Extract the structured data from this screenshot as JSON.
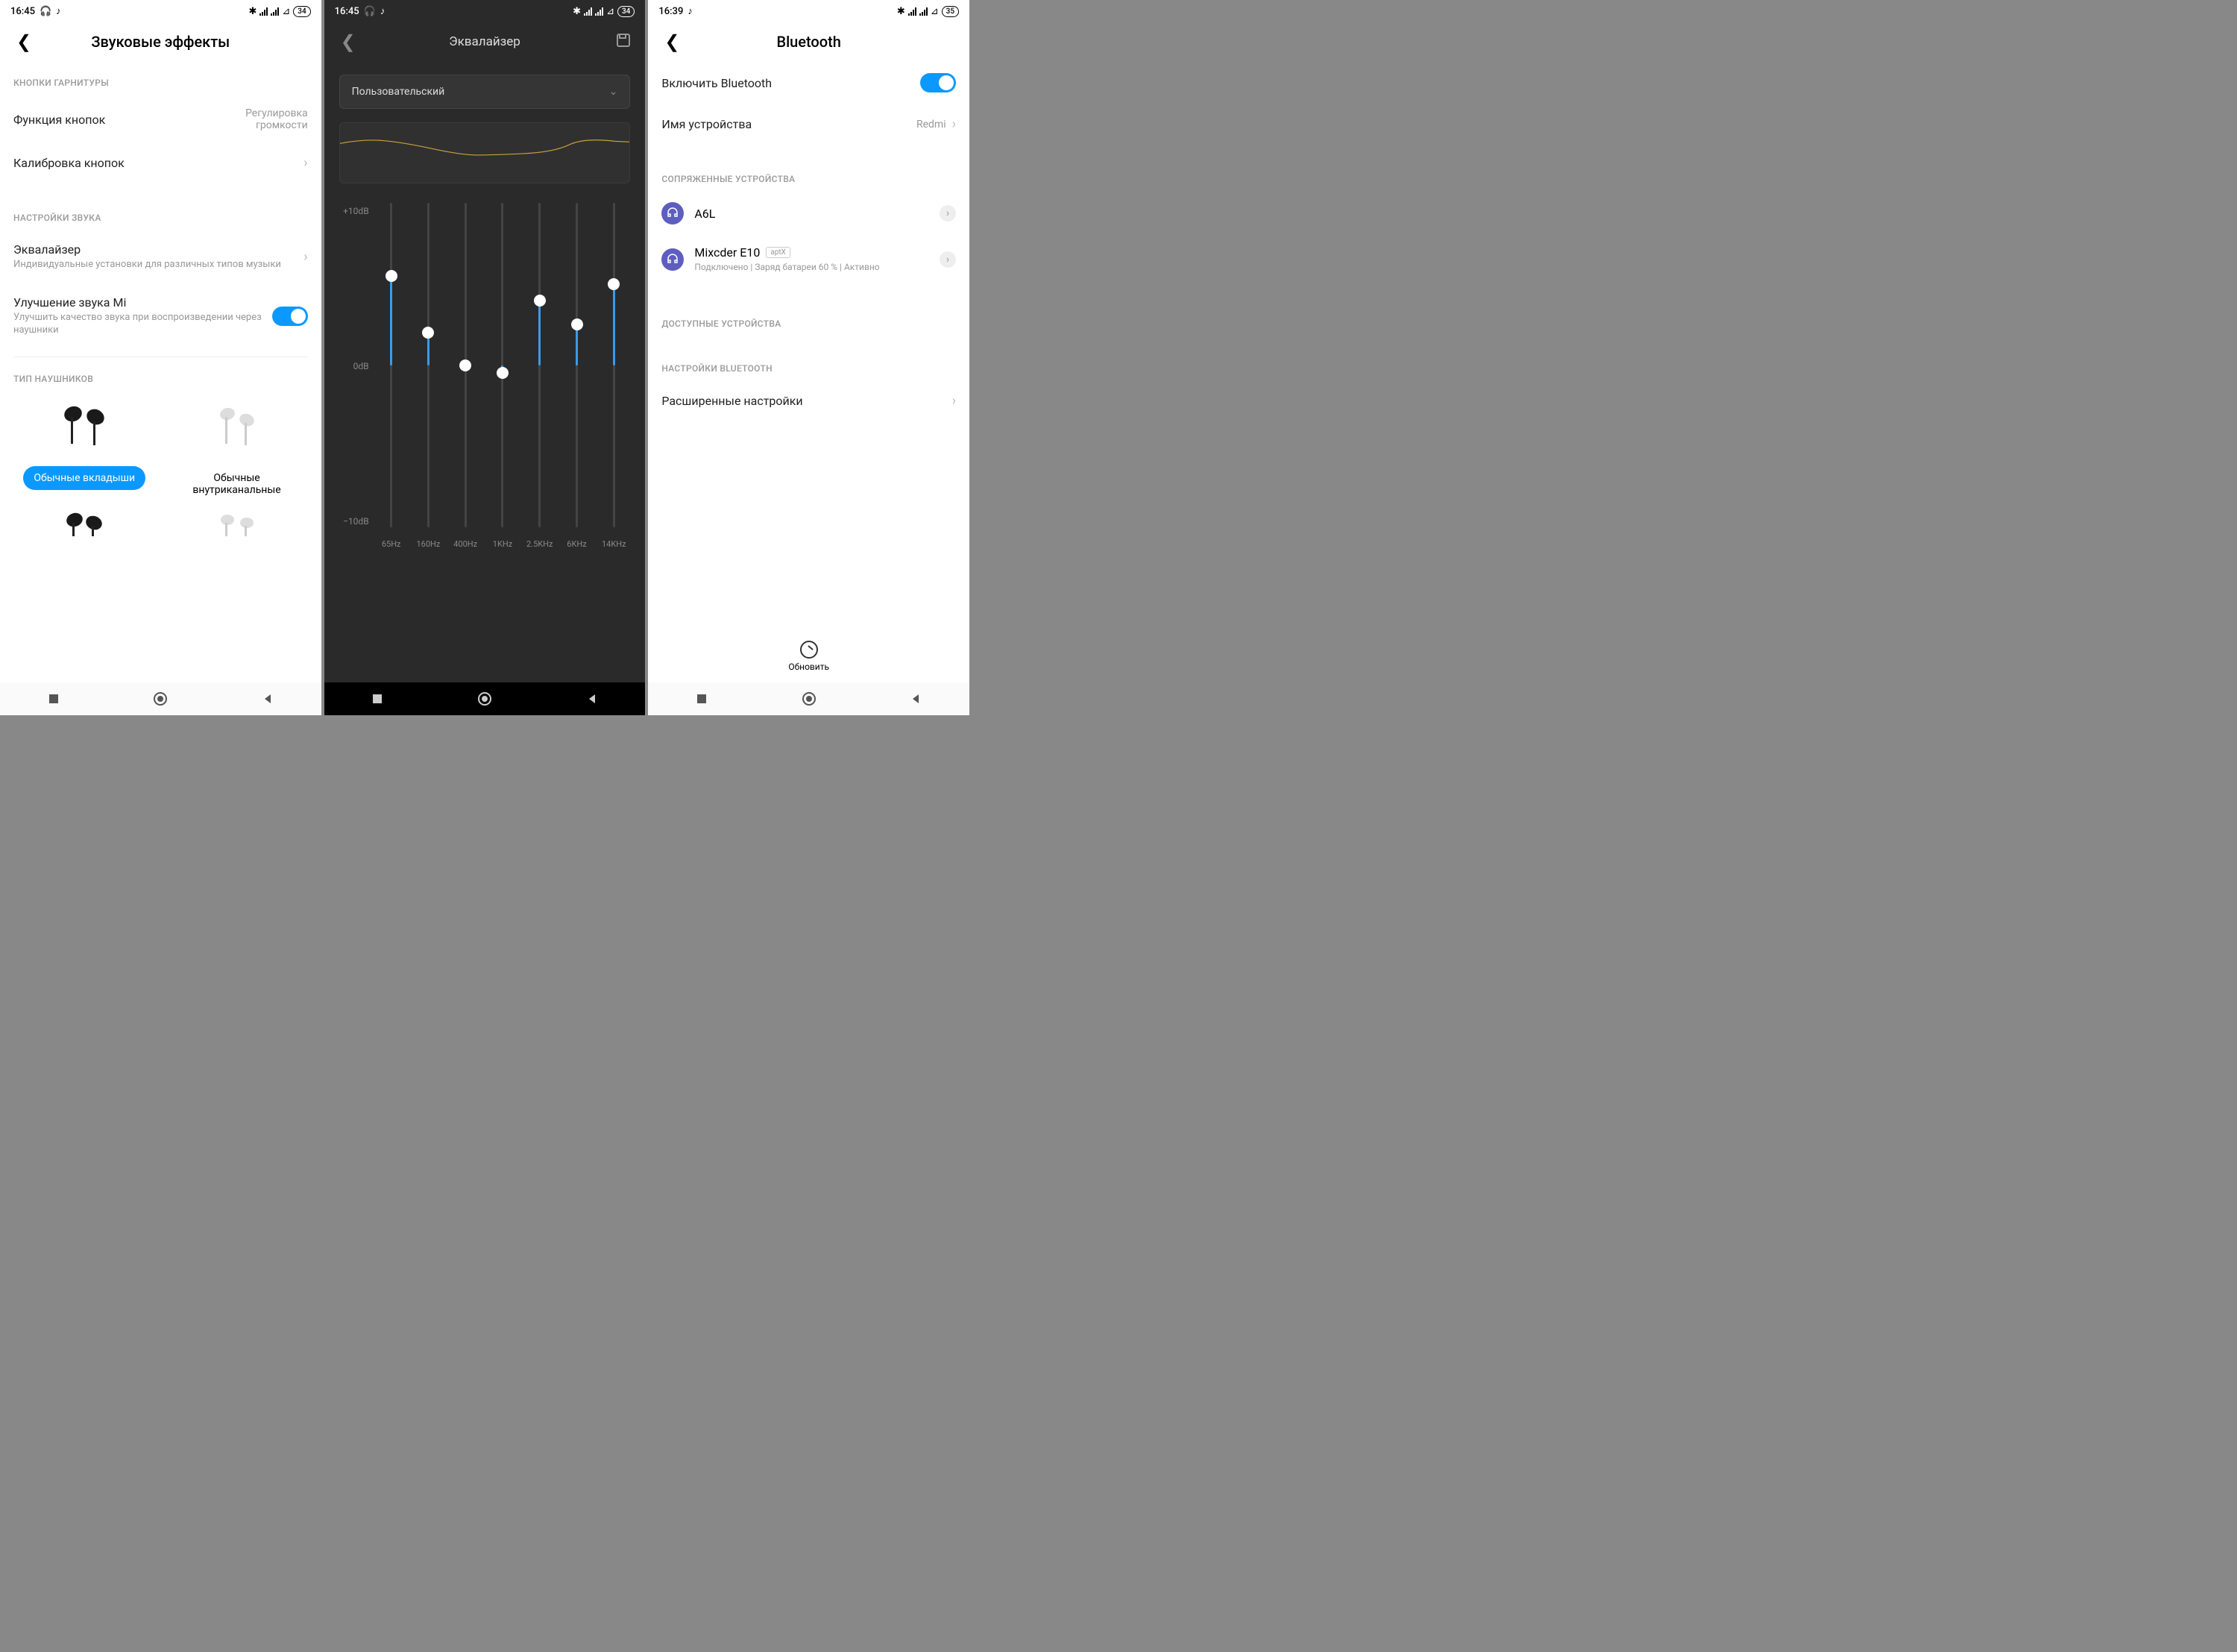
{
  "screen1": {
    "status": {
      "time": "16:45",
      "battery": "34"
    },
    "title": "Звуковые эффекты",
    "sections": {
      "headset_buttons": {
        "title": "КНОПКИ ГАРНИТУРЫ",
        "button_func": {
          "label": "Функция кнопок",
          "value": "Регулировка громкости"
        },
        "calibration": "Калибровка кнопок"
      },
      "sound": {
        "title": "НАСТРОЙКИ ЗВУКА",
        "eq": {
          "label": "Эквалайзер",
          "sub": "Индивидуальные установки для различных типов музыки"
        },
        "enhance": {
          "label": "Улучшение звука Mi",
          "sub": "Улучшить качество звука при воспроизведении через наушники"
        }
      },
      "hp_type": {
        "title": "ТИП НАУШНИКОВ",
        "opt1": "Обычные вкладыши",
        "opt2": "Обычные внутриканальные"
      }
    }
  },
  "screen2": {
    "status": {
      "time": "16:45",
      "battery": "34"
    },
    "title": "Эквалайзер",
    "preset": "Пользовательский",
    "axis": {
      "top": "+10dB",
      "mid": "0dB",
      "bot": "−10dB"
    },
    "chart_data": {
      "type": "bar",
      "xlabel": "",
      "ylabel": "dB",
      "ylim": [
        -10,
        10
      ],
      "categories": [
        "65Hz",
        "160Hz",
        "400Hz",
        "1KHz",
        "2.5KHz",
        "6KHz",
        "14KHz"
      ],
      "values": [
        5.5,
        2.0,
        0.0,
        -0.5,
        4.0,
        2.5,
        5.0
      ]
    }
  },
  "screen3": {
    "status": {
      "time": "16:39",
      "battery": "35"
    },
    "title": "Bluetooth",
    "enable": {
      "label": "Включить Bluetooth"
    },
    "device_name": {
      "label": "Имя устройства",
      "value": "Redmi"
    },
    "paired": {
      "title": "СОПРЯЖЕННЫЕ УСТРОЙСТВА",
      "d1": {
        "name": "A6L"
      },
      "d2": {
        "name": "Mixcder E10",
        "badge": "aptX",
        "status": "Подключено | Заряд батареи 60 % | Активно"
      }
    },
    "available_title": "ДОСТУПНЫЕ УСТРОЙСТВА",
    "bt_settings_title": "НАСТРОЙКИ BLUETOOTH",
    "advanced": "Расширенные настройки",
    "refresh": "Обновить"
  }
}
